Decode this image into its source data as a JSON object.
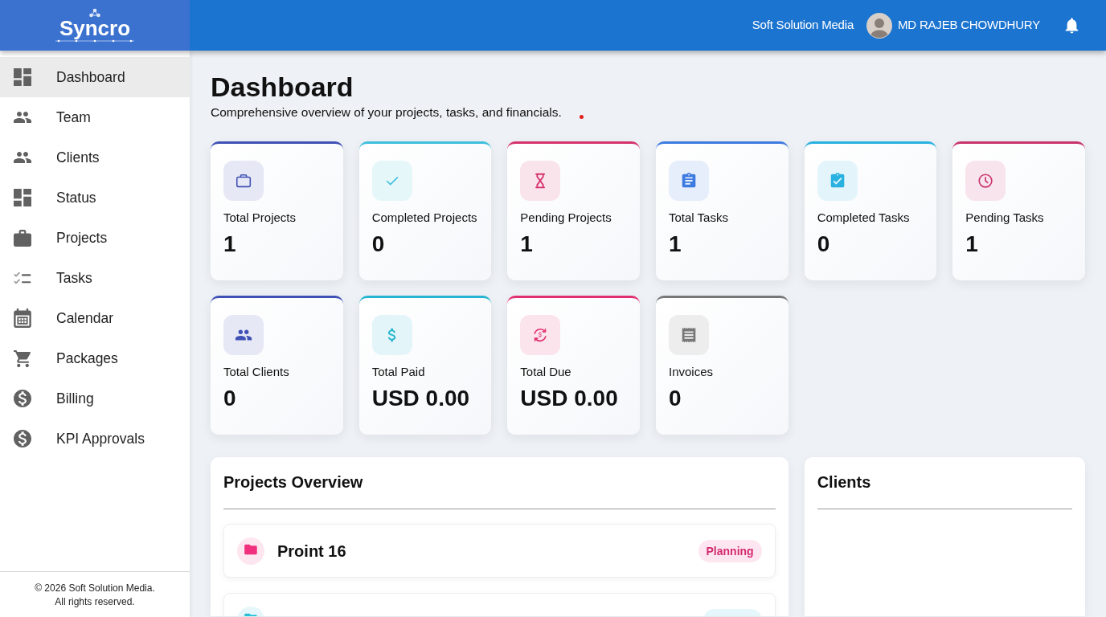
{
  "brand": {
    "name": "Syncro"
  },
  "header": {
    "company": "Soft Solution Media",
    "user_name": "MD RAJEB CHOWDHURY"
  },
  "sidebar": {
    "items": [
      {
        "label": "Dashboard",
        "selected": true
      },
      {
        "label": "Team",
        "selected": false
      },
      {
        "label": "Clients",
        "selected": false
      },
      {
        "label": "Status",
        "selected": false
      },
      {
        "label": "Projects",
        "selected": false
      },
      {
        "label": "Tasks",
        "selected": false
      },
      {
        "label": "Calendar",
        "selected": false
      },
      {
        "label": "Packages",
        "selected": false
      },
      {
        "label": "Billing",
        "selected": false
      },
      {
        "label": "KPI Approvals",
        "selected": false
      }
    ],
    "footer": [
      "© 2026 Soft Solution Media.",
      "All rights reserved."
    ]
  },
  "page": {
    "title": "Dashboard",
    "subtitle": "Comprehensive overview of your projects, tasks, and financials."
  },
  "stat_cards": [
    {
      "label": "Total Projects",
      "value": "1",
      "color": "#3f51b5"
    },
    {
      "label": "Completed Projects",
      "value": "0",
      "color": "#3fbfdc"
    },
    {
      "label": "Pending Projects",
      "value": "1",
      "color": "#d6336c"
    },
    {
      "label": "Total Tasks",
      "value": "1",
      "color": "#3d7be0"
    },
    {
      "label": "Completed Tasks",
      "value": "0",
      "color": "#29b1e0"
    },
    {
      "label": "Pending Tasks",
      "value": "1",
      "color": "#c8336b"
    },
    {
      "label": "Total Clients",
      "value": "0",
      "color": "#3f51b5"
    },
    {
      "label": "Total Paid",
      "value": "USD 0.00",
      "color": "#26b5d0"
    },
    {
      "label": "Total Due",
      "value": "USD 0.00",
      "color": "#e0306f"
    },
    {
      "label": "Invoices",
      "value": "0",
      "color": "#777777"
    }
  ],
  "projects_overview": {
    "title": "Projects Overview",
    "projects": [
      {
        "name": "Proint 16",
        "status": "Planning",
        "color": "#f0307f"
      },
      {
        "color": "#26c0d8"
      }
    ]
  },
  "clients_panel": {
    "title": "Clients"
  }
}
